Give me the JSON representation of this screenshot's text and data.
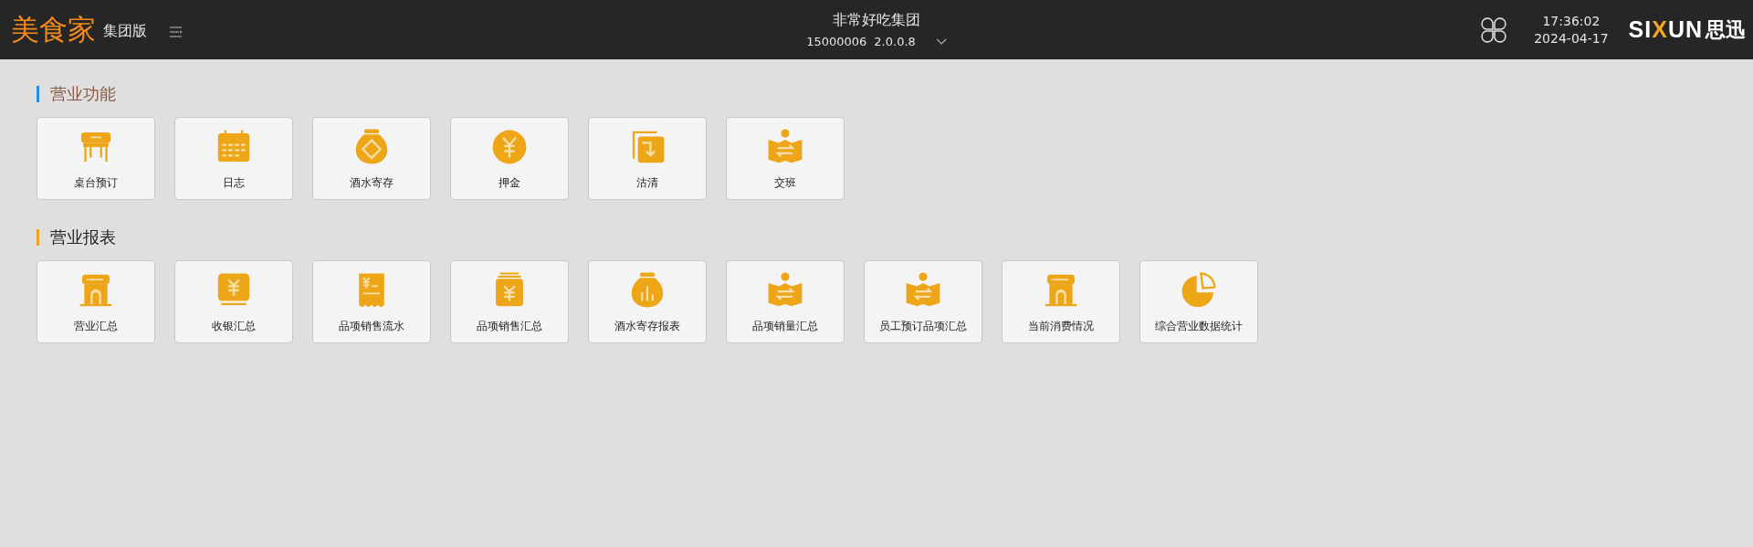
{
  "header": {
    "logo": "美食家",
    "edition": "集团版",
    "company": "非常好吃集团",
    "store_code": "15000006",
    "version": "2.0.0.8",
    "time": "17:36:02",
    "date": "2024-04-17",
    "brand": [
      {
        "text": "SI",
        "accent": false
      },
      {
        "text": "X",
        "accent": true
      },
      {
        "text": "UN",
        "accent": false
      }
    ],
    "brand_cn": "思迅"
  },
  "sections": [
    {
      "title": "营业功能",
      "color": "#2f8fe0",
      "tiles": [
        {
          "label": "桌台预订"
        },
        {
          "label": "日志"
        },
        {
          "label": "酒水寄存"
        },
        {
          "label": "押金"
        },
        {
          "label": "沽清"
        },
        {
          "label": "交班"
        }
      ]
    },
    {
      "title": "营业报表",
      "color": "#eea517",
      "tiles": [
        {
          "label": "营业汇总"
        },
        {
          "label": "收银汇总"
        },
        {
          "label": "品项销售流水"
        },
        {
          "label": "品项销售汇总"
        },
        {
          "label": "酒水寄存报表"
        },
        {
          "label": "品项销量汇总"
        },
        {
          "label": "员工预订品项汇总"
        },
        {
          "label": "当前消费情况"
        },
        {
          "label": "综合营业数据统计"
        }
      ]
    }
  ]
}
